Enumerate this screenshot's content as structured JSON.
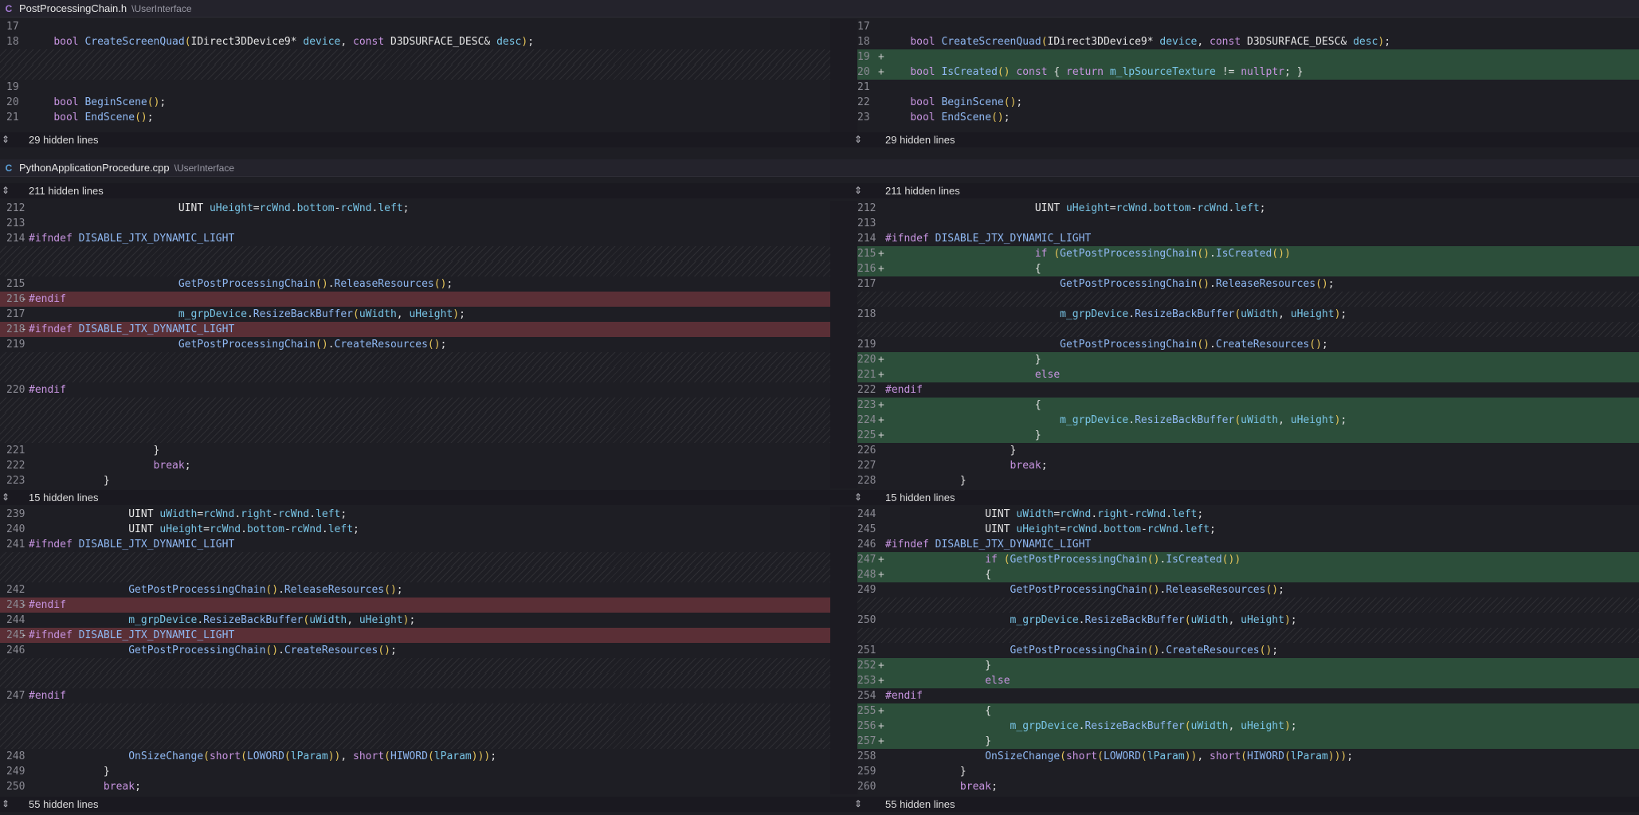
{
  "files": [
    {
      "name": "PostProcessingChain.h",
      "path": "\\UserInterface",
      "icon": "c-header-icon",
      "icon_glyph": "C",
      "icon_color": "#a57bd6",
      "rows": [
        {
          "l_ln": "17",
          "l_mk": "",
          "l_code": "",
          "l_type": "ctx",
          "r_ln": "17",
          "r_mk": "",
          "r_code": "",
          "r_type": "ctx"
        },
        {
          "l_ln": "18",
          "l_code": "    bool CreateScreenQuad(IDirect3DDevice9* device, const D3DSURFACE_DESC& desc);",
          "l_type": "ctx",
          "r_ln": "18",
          "r_code": "    bool CreateScreenQuad(IDirect3DDevice9* device, const D3DSURFACE_DESC& desc);",
          "r_type": "ctx"
        },
        {
          "l_ln": "",
          "l_code": "",
          "l_type": "gap",
          "r_ln": "19",
          "r_mk": "+",
          "r_code": "",
          "r_type": "add"
        },
        {
          "l_ln": "",
          "l_code": "",
          "l_type": "gap",
          "r_ln": "20",
          "r_mk": "+",
          "r_code": "    bool IsCreated() const { return m_lpSourceTexture != nullptr; }",
          "r_type": "add"
        },
        {
          "l_ln": "19",
          "l_code": "",
          "l_type": "ctx",
          "r_ln": "21",
          "r_code": "",
          "r_type": "ctx"
        },
        {
          "l_ln": "20",
          "l_code": "    bool BeginScene();",
          "l_type": "ctx",
          "r_ln": "22",
          "r_code": "    bool BeginScene();",
          "r_type": "ctx"
        },
        {
          "l_ln": "21",
          "l_code": "    bool EndScene();",
          "l_type": "ctx",
          "r_ln": "23",
          "r_code": "    bool EndScene();",
          "r_type": "ctx"
        }
      ],
      "hidden_after": {
        "left": "29 hidden lines",
        "right": "29 hidden lines"
      }
    },
    {
      "name": "PythonApplicationProcedure.cpp",
      "path": "\\UserInterface",
      "icon": "cpp-file-icon",
      "icon_glyph": "C",
      "icon_color": "#5a9fd8",
      "hidden_before": {
        "left": "211 hidden lines",
        "right": "211 hidden lines"
      }
    }
  ],
  "hunks": [
    {
      "rows": [
        {
          "l_ln": "212",
          "l_code": "                        UINT uHeight=rcWnd.bottom-rcWnd.left;",
          "l_type": "ctx",
          "r_ln": "212",
          "r_code": "                        UINT uHeight=rcWnd.bottom-rcWnd.left;",
          "r_type": "ctx"
        },
        {
          "l_ln": "213",
          "l_code": "",
          "l_type": "ctx",
          "r_ln": "213",
          "r_code": "",
          "r_type": "ctx"
        },
        {
          "l_ln": "214",
          "l_code": "#ifndef DISABLE_JTX_DYNAMIC_LIGHT",
          "l_type": "ctx",
          "r_ln": "214",
          "r_code": "#ifndef DISABLE_JTX_DYNAMIC_LIGHT",
          "r_type": "ctx"
        },
        {
          "l_ln": "",
          "l_code": "",
          "l_type": "gap",
          "r_ln": "215",
          "r_mk": "+",
          "r_code": "                        if (GetPostProcessingChain().IsCreated())",
          "r_type": "add"
        },
        {
          "l_ln": "",
          "l_code": "",
          "l_type": "gap",
          "r_ln": "216",
          "r_mk": "+",
          "r_code": "                        {",
          "r_type": "add"
        },
        {
          "l_ln": "215",
          "l_code": "                        GetPostProcessingChain().ReleaseResources();",
          "l_type": "ctx",
          "r_ln": "217",
          "r_code": "                            GetPostProcessingChain().ReleaseResources();",
          "r_type": "ctx"
        },
        {
          "l_ln": "216",
          "l_mk": "-",
          "l_code": "#endif",
          "l_type": "del",
          "r_ln": "",
          "r_code": "",
          "r_type": "gap"
        },
        {
          "l_ln": "217",
          "l_code": "                        m_grpDevice.ResizeBackBuffer(uWidth, uHeight);",
          "l_type": "ctx",
          "r_ln": "218",
          "r_code": "                            m_grpDevice.ResizeBackBuffer(uWidth, uHeight);",
          "r_type": "ctx"
        },
        {
          "l_ln": "218",
          "l_mk": "-",
          "l_code": "#ifndef DISABLE_JTX_DYNAMIC_LIGHT",
          "l_type": "del",
          "r_ln": "",
          "r_code": "",
          "r_type": "gap"
        },
        {
          "l_ln": "219",
          "l_code": "                        GetPostProcessingChain().CreateResources();",
          "l_type": "ctx",
          "r_ln": "219",
          "r_code": "                            GetPostProcessingChain().CreateResources();",
          "r_type": "ctx"
        },
        {
          "l_ln": "",
          "l_code": "",
          "l_type": "gap",
          "r_ln": "220",
          "r_mk": "+",
          "r_code": "                        }",
          "r_type": "add"
        },
        {
          "l_ln": "",
          "l_code": "",
          "l_type": "gap",
          "r_ln": "221",
          "r_mk": "+",
          "r_code": "                        else",
          "r_type": "add"
        },
        {
          "l_ln": "220",
          "l_code": "#endif",
          "l_type": "ctx",
          "r_ln": "222",
          "r_code": "#endif",
          "r_type": "ctx"
        },
        {
          "l_ln": "",
          "l_code": "",
          "l_type": "gap",
          "r_ln": "223",
          "r_mk": "+",
          "r_code": "                        {",
          "r_type": "add"
        },
        {
          "l_ln": "",
          "l_code": "",
          "l_type": "gap",
          "r_ln": "224",
          "r_mk": "+",
          "r_code": "                            m_grpDevice.ResizeBackBuffer(uWidth, uHeight);",
          "r_type": "add"
        },
        {
          "l_ln": "",
          "l_code": "",
          "l_type": "gap",
          "r_ln": "225",
          "r_mk": "+",
          "r_code": "                        }",
          "r_type": "add"
        },
        {
          "l_ln": "221",
          "l_code": "                    }",
          "l_type": "ctx",
          "r_ln": "226",
          "r_code": "                    }",
          "r_type": "ctx"
        },
        {
          "l_ln": "222",
          "l_code": "                    break;",
          "l_type": "ctx",
          "r_ln": "227",
          "r_code": "                    break;",
          "r_type": "ctx"
        },
        {
          "l_ln": "223",
          "l_code": "            }",
          "l_type": "ctx",
          "r_ln": "228",
          "r_code": "            }",
          "r_type": "ctx"
        }
      ],
      "hidden_after": {
        "left": "15 hidden lines",
        "right": "15 hidden lines"
      }
    },
    {
      "rows": [
        {
          "l_ln": "239",
          "l_code": "                UINT uWidth=rcWnd.right-rcWnd.left;",
          "l_type": "ctx",
          "r_ln": "244",
          "r_code": "                UINT uWidth=rcWnd.right-rcWnd.left;",
          "r_type": "ctx"
        },
        {
          "l_ln": "240",
          "l_code": "                UINT uHeight=rcWnd.bottom-rcWnd.left;",
          "l_type": "ctx",
          "r_ln": "245",
          "r_code": "                UINT uHeight=rcWnd.bottom-rcWnd.left;",
          "r_type": "ctx"
        },
        {
          "l_ln": "241",
          "l_code": "#ifndef DISABLE_JTX_DYNAMIC_LIGHT",
          "l_type": "ctx",
          "r_ln": "246",
          "r_code": "#ifndef DISABLE_JTX_DYNAMIC_LIGHT",
          "r_type": "ctx"
        },
        {
          "l_ln": "",
          "l_code": "",
          "l_type": "gap",
          "r_ln": "247",
          "r_mk": "+",
          "r_code": "                if (GetPostProcessingChain().IsCreated())",
          "r_type": "add"
        },
        {
          "l_ln": "",
          "l_code": "",
          "l_type": "gap",
          "r_ln": "248",
          "r_mk": "+",
          "r_code": "                {",
          "r_type": "add"
        },
        {
          "l_ln": "242",
          "l_code": "                GetPostProcessingChain().ReleaseResources();",
          "l_type": "ctx",
          "r_ln": "249",
          "r_code": "                    GetPostProcessingChain().ReleaseResources();",
          "r_type": "ctx"
        },
        {
          "l_ln": "243",
          "l_mk": "-",
          "l_code": "#endif",
          "l_type": "del",
          "r_ln": "",
          "r_code": "",
          "r_type": "gap"
        },
        {
          "l_ln": "244",
          "l_code": "                m_grpDevice.ResizeBackBuffer(uWidth, uHeight);",
          "l_type": "ctx",
          "r_ln": "250",
          "r_code": "                    m_grpDevice.ResizeBackBuffer(uWidth, uHeight);",
          "r_type": "ctx"
        },
        {
          "l_ln": "245",
          "l_mk": "-",
          "l_code": "#ifndef DISABLE_JTX_DYNAMIC_LIGHT",
          "l_type": "del",
          "r_ln": "",
          "r_code": "",
          "r_type": "gap"
        },
        {
          "l_ln": "246",
          "l_code": "                GetPostProcessingChain().CreateResources();",
          "l_type": "ctx",
          "r_ln": "251",
          "r_code": "                    GetPostProcessingChain().CreateResources();",
          "r_type": "ctx"
        },
        {
          "l_ln": "",
          "l_code": "",
          "l_type": "gap",
          "r_ln": "252",
          "r_mk": "+",
          "r_code": "                }",
          "r_type": "add"
        },
        {
          "l_ln": "",
          "l_code": "",
          "l_type": "gap",
          "r_ln": "253",
          "r_mk": "+",
          "r_code": "                else",
          "r_type": "add"
        },
        {
          "l_ln": "247",
          "l_code": "#endif",
          "l_type": "ctx",
          "r_ln": "254",
          "r_code": "#endif",
          "r_type": "ctx"
        },
        {
          "l_ln": "",
          "l_code": "",
          "l_type": "gap",
          "r_ln": "255",
          "r_mk": "+",
          "r_code": "                {",
          "r_type": "add"
        },
        {
          "l_ln": "",
          "l_code": "",
          "l_type": "gap",
          "r_ln": "256",
          "r_mk": "+",
          "r_code": "                    m_grpDevice.ResizeBackBuffer(uWidth, uHeight);",
          "r_type": "add"
        },
        {
          "l_ln": "",
          "l_code": "",
          "l_type": "gap",
          "r_ln": "257",
          "r_mk": "+",
          "r_code": "                }",
          "r_type": "add"
        },
        {
          "l_ln": "248",
          "l_code": "                OnSizeChange(short(LOWORD(lParam)), short(HIWORD(lParam)));",
          "l_type": "ctx",
          "r_ln": "258",
          "r_code": "                OnSizeChange(short(LOWORD(lParam)), short(HIWORD(lParam)));",
          "r_type": "ctx"
        },
        {
          "l_ln": "249",
          "l_code": "            }",
          "l_type": "ctx",
          "r_ln": "259",
          "r_code": "            }",
          "r_type": "ctx"
        },
        {
          "l_ln": "250",
          "l_code": "            break;",
          "l_type": "ctx",
          "r_ln": "260",
          "r_code": "            break;",
          "r_type": "ctx"
        }
      ],
      "hidden_after": {
        "left": "55 hidden lines",
        "right": "55 hidden lines"
      }
    }
  ],
  "colors": {
    "background": "#1e1e24",
    "added_line": "#2c4e3a",
    "deleted_line": "#5a2f36",
    "keyword": "#c794e0",
    "function": "#8fb8f2",
    "member": "#79c6e8",
    "paren": "#e6c55a"
  },
  "icons": {
    "expand": "unfold-icon"
  }
}
